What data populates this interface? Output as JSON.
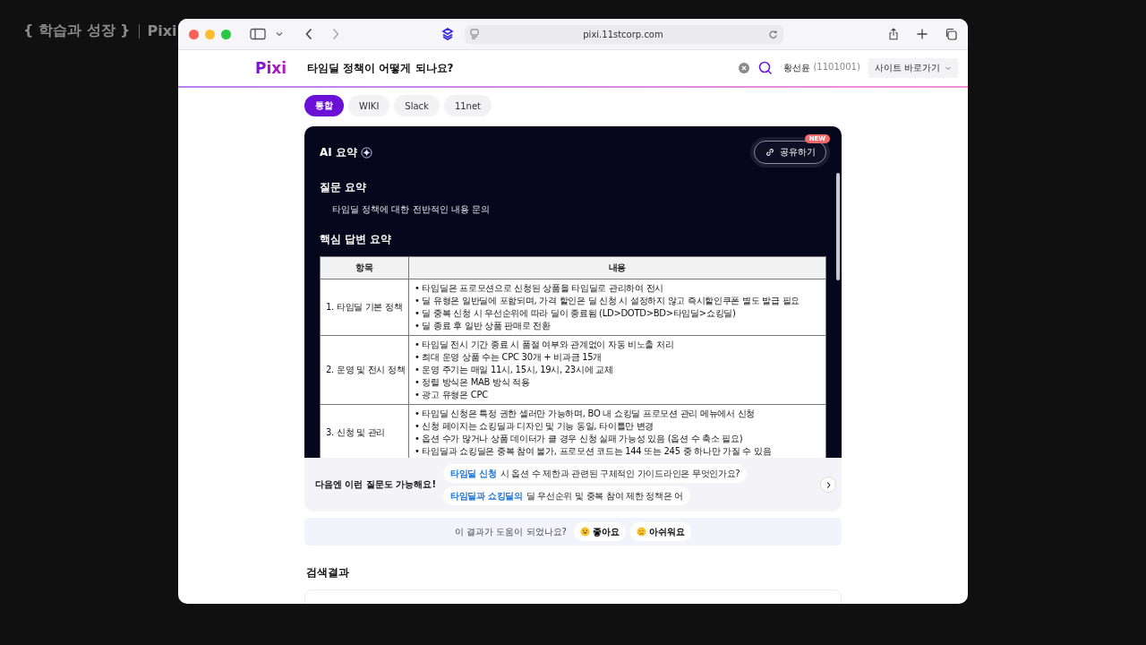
{
  "caption": {
    "title": "{ 학습과 성장 }",
    "app": "Pixi"
  },
  "browser": {
    "url": "pixi.11stcorp.com"
  },
  "header": {
    "logo": "Pixi",
    "query": "타임딜 정책이 어떻게 되나요?",
    "user_name": "황선윤",
    "user_id": "(1101001)",
    "site_menu": "사이트 바로가기"
  },
  "tabs": [
    {
      "label": "통합",
      "selected": true
    },
    {
      "label": "WIKI",
      "selected": false
    },
    {
      "label": "Slack",
      "selected": false
    },
    {
      "label": "11net",
      "selected": false
    }
  ],
  "ai_summary": {
    "title": "AI 요약",
    "share_button": "공유하기",
    "share_badge": "NEW",
    "question_heading": "질문 요약",
    "question_text": "타임딜 정책에 대한 전반적인 내용 문의",
    "answer_heading": "핵심 답변 요약",
    "table": {
      "columns": [
        "항목",
        "내용"
      ],
      "rows": [
        {
          "item": "1. 타임딜 기본 정책",
          "bullets": [
            "• 타임딜은 프로모션으로 신청된 상품을 타임딜로 관리하여 전시",
            "• 딜 유형은 일반딜에 포함되며, 가격 할인은 딜 신청 시 설정하지 않고 즉시할인쿠폰 별도 발급 필요",
            "• 딜 중복 신청 시 우선순위에 따라 딜이 종료됨 (LD>DOTD>BD>타임딜>쇼킹딜)",
            "• 딜 종료 후 일반 상품 판매로 전환"
          ]
        },
        {
          "item": "2. 운영 및 전시 정책",
          "bullets": [
            "• 타임딜 전시 기간 종료 시 품절 여부와 관계없이 자동 비노출 처리",
            "• 최대 운영 상품 수는 CPC 30개 + 비과금 15개",
            "• 운영 주기는 매일 11시, 15시, 19시, 23시에 교체",
            "• 정렬 방식은 MAB 방식 적용",
            "• 광고 유형은 CPC"
          ]
        },
        {
          "item": "3. 신청 및 관리",
          "bullets": [
            "• 타임딜 신청은 특정 권한 셀러만 가능하며, BO 내 쇼킹딜 프로모션 관리 메뉴에서 신청",
            "• 신청 페이지는 쇼킹딜과 디자인 및 기능 동일, 타이틀만 변경",
            "• 옵션 수가 많거나 상품 데이터가 클 경우 신청 실패 가능성 있음 (옵션 수 축소 필요)",
            "• 타임딜과 쇼킹딜은 중복 참여 불가, 프로모션 코드는 144 또는 245 중 하나만 가질 수 있음"
          ]
        }
      ]
    }
  },
  "suggestions": {
    "label": "다음엔 이런 질문도 가능해요!",
    "items": [
      {
        "highlight": "타임딜 신청",
        "text": "시 옵션 수 제한과 관련된 구체적인 가이드라인은 무엇인가요?"
      },
      {
        "highlight": "타임딜과 쇼킹딜의",
        "text": "딜 우선순위 및 중복 참여 제한 정책은 어"
      }
    ]
  },
  "feedback": {
    "question": "이 결과가 도움이 되었나요?",
    "buttons": [
      {
        "label": "좋아요",
        "kind": "smile"
      },
      {
        "label": "아쉬워요",
        "kind": "sad"
      }
    ]
  },
  "results": {
    "heading": "검색결과"
  }
}
